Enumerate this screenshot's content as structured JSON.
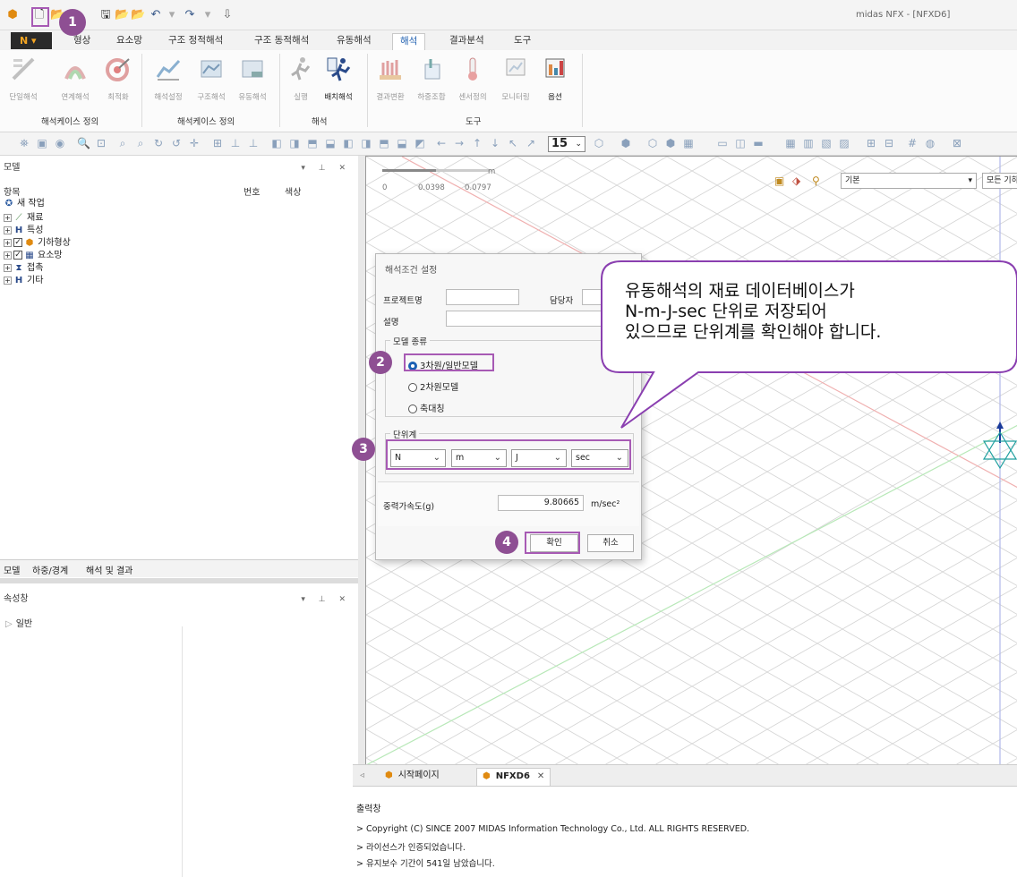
{
  "window": {
    "title": "midas NFX - [NFXD6]"
  },
  "ribbon": {
    "tabs": [
      "형상",
      "요소망",
      "구조 정적해석",
      "구조 동적해석",
      "유동해석",
      "해석",
      "결과분석",
      "도구"
    ],
    "active_tab": "해석",
    "buttons": [
      "단일해석",
      "연계해석",
      "최적화",
      "해석설정",
      "구조해석",
      "유동해석",
      "실행",
      "배치해석",
      "결과변환",
      "하중조합",
      "센서정의",
      "모니터링",
      "옵션"
    ],
    "groups": [
      "해석케이스 정의",
      "해석케이스 정의",
      "해석",
      "도구"
    ]
  },
  "toolbar": {
    "zoom_value": "15"
  },
  "model_panel": {
    "title": "모델",
    "columns": [
      "항목",
      "번호",
      "색상"
    ],
    "tree": [
      "새 작업",
      "재료",
      "특성",
      "기하형상",
      "요소망",
      "접촉",
      "기타"
    ]
  },
  "bottom_tabs": [
    "모델",
    "하중/경계",
    "해석 및 결과"
  ],
  "property_panel": {
    "title": "속성창",
    "group": "일반"
  },
  "viewport": {
    "scale_labels": [
      "0",
      "0.0398",
      "0.0797"
    ],
    "scale_unit": "m",
    "combo_view": "기본",
    "combo_geometry": "모든 기하형상"
  },
  "doc_tabs": [
    "시작페이지",
    "NFXD6"
  ],
  "output": {
    "title": "출력창",
    "lines": [
      "> Copyright (C) SINCE 2007 MIDAS Information Technology Co., Ltd. ALL RIGHTS RESERVED.",
      "> 라이선스가 인증되었습니다.",
      "> 유지보수 기간이 541일 남았습니다."
    ]
  },
  "dialog": {
    "title": "해석조건 설정",
    "project_label": "프로젝트명",
    "manager_label": "담당자",
    "desc_label": "설명",
    "model_type_label": "모델 종류",
    "model_types": [
      "3차원/일반모델",
      "2차원모델",
      "축대칭"
    ],
    "selected_model_type": "3차원/일반모델",
    "unit_label": "단위계",
    "units": [
      "N",
      "m",
      "J",
      "sec"
    ],
    "gravity_label": "중력가속도(g)",
    "gravity_value": "9.80665",
    "gravity_unit": "m/sec²",
    "ok": "확인",
    "cancel": "취소"
  },
  "callout": {
    "lines": [
      "유동해석의 재료 데이터베이스가",
      "N-m-J-sec 단위로 저장되어",
      "있으므로 단위계를 확인해야 합니다."
    ]
  },
  "badges": [
    "1",
    "2",
    "3",
    "4"
  ],
  "colors": {
    "highlight": "#a75ab4",
    "badge": "#8e4f93",
    "active_tab_text": "#2060b0",
    "radio_selected": "#1a5fb4"
  }
}
